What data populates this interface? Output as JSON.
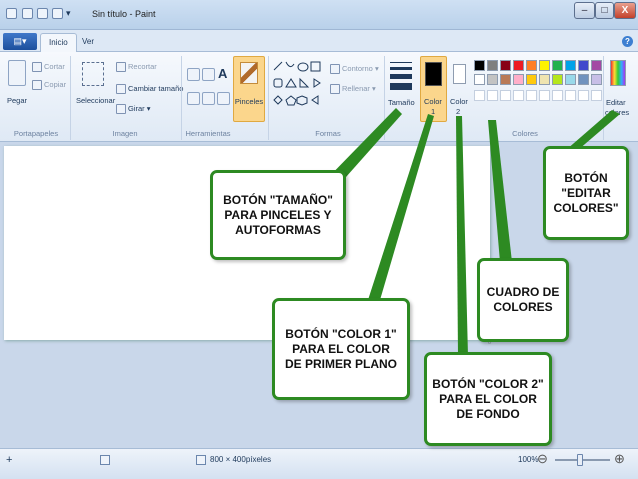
{
  "window": {
    "title": "Sin título - Paint",
    "minimize": "–",
    "maximize": "□",
    "close": "X"
  },
  "tabs": {
    "paint_menu": "▾",
    "inicio": "Inicio",
    "ver": "Ver"
  },
  "ribbon": {
    "portapapeles": {
      "pegar": "Pegar",
      "cortar": "Cortar",
      "copiar": "Copiar",
      "label": "Portapapeles"
    },
    "imagen": {
      "seleccionar": "Seleccionar",
      "recortar": "Recortar",
      "cambiar_tamano": "Cambiar tamaño",
      "girar": "Girar",
      "label": "Imagen"
    },
    "herramientas": {
      "label": "Herramientas",
      "text_tool": "A"
    },
    "pinceles": "Pinceles",
    "formas": {
      "contorno": "Contorno",
      "rellenar": "Rellenar",
      "label": "Formas"
    },
    "tamano": "Tamaño",
    "color1": {
      "line1": "Color",
      "line2": "1"
    },
    "color2": {
      "line1": "Color",
      "line2": "2"
    },
    "colores_label": "Colores",
    "editar_colores": {
      "line1": "Editar",
      "line2": "colores"
    }
  },
  "palette": {
    "row1": [
      "#000000",
      "#7f7f7f",
      "#880015",
      "#ed1c24",
      "#ff7f27",
      "#fff200",
      "#22b14c",
      "#00a2e8",
      "#3f48cc",
      "#a349a4"
    ],
    "row2": [
      "#ffffff",
      "#c3c3c3",
      "#b97a57",
      "#ffaec9",
      "#ffc90e",
      "#efe4b0",
      "#b5e61d",
      "#99d9ea",
      "#7092be",
      "#c8bfe7"
    ]
  },
  "colors": {
    "accent_green": "#2d8a22",
    "color1": "#000000",
    "color2": "#ffffff",
    "pinceles_active": "#fbd68c"
  },
  "status": {
    "dimensions": "800 × 400píxeles",
    "zoom": "100%",
    "zoom_out": "⊖",
    "zoom_in": "⊕",
    "cursor_icon": "+"
  },
  "callouts": {
    "tamano": [
      "BOTÓN \"TAMAÑO\"",
      "PARA PINCELES Y",
      "AUTOFORMAS"
    ],
    "editar": [
      "BOTÓN",
      "\"EDITAR",
      "COLORES\""
    ],
    "cuadro": [
      "CUADRO DE",
      "COLORES"
    ],
    "color1": [
      "BOTÓN \"COLOR 1\"",
      "PARA EL COLOR",
      "DE PRIMER PLANO"
    ],
    "color2": [
      "BOTÓN \"COLOR 2\"",
      "PARA EL COLOR",
      "DE FONDO"
    ]
  },
  "canvas_handle": "▫"
}
